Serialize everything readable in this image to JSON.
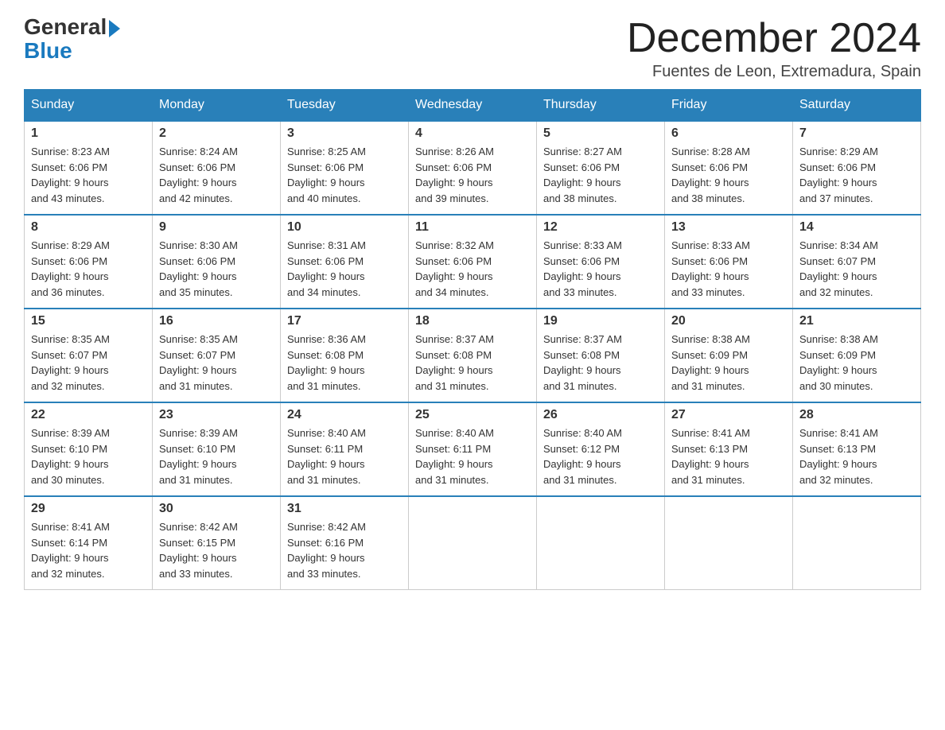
{
  "header": {
    "logo_line1": "General",
    "logo_line2": "Blue",
    "month_title": "December 2024",
    "location": "Fuentes de Leon, Extremadura, Spain"
  },
  "days_of_week": [
    "Sunday",
    "Monday",
    "Tuesday",
    "Wednesday",
    "Thursday",
    "Friday",
    "Saturday"
  ],
  "weeks": [
    [
      {
        "day": "1",
        "sunrise": "8:23 AM",
        "sunset": "6:06 PM",
        "daylight": "9 hours and 43 minutes."
      },
      {
        "day": "2",
        "sunrise": "8:24 AM",
        "sunset": "6:06 PM",
        "daylight": "9 hours and 42 minutes."
      },
      {
        "day": "3",
        "sunrise": "8:25 AM",
        "sunset": "6:06 PM",
        "daylight": "9 hours and 40 minutes."
      },
      {
        "day": "4",
        "sunrise": "8:26 AM",
        "sunset": "6:06 PM",
        "daylight": "9 hours and 39 minutes."
      },
      {
        "day": "5",
        "sunrise": "8:27 AM",
        "sunset": "6:06 PM",
        "daylight": "9 hours and 38 minutes."
      },
      {
        "day": "6",
        "sunrise": "8:28 AM",
        "sunset": "6:06 PM",
        "daylight": "9 hours and 38 minutes."
      },
      {
        "day": "7",
        "sunrise": "8:29 AM",
        "sunset": "6:06 PM",
        "daylight": "9 hours and 37 minutes."
      }
    ],
    [
      {
        "day": "8",
        "sunrise": "8:29 AM",
        "sunset": "6:06 PM",
        "daylight": "9 hours and 36 minutes."
      },
      {
        "day": "9",
        "sunrise": "8:30 AM",
        "sunset": "6:06 PM",
        "daylight": "9 hours and 35 minutes."
      },
      {
        "day": "10",
        "sunrise": "8:31 AM",
        "sunset": "6:06 PM",
        "daylight": "9 hours and 34 minutes."
      },
      {
        "day": "11",
        "sunrise": "8:32 AM",
        "sunset": "6:06 PM",
        "daylight": "9 hours and 34 minutes."
      },
      {
        "day": "12",
        "sunrise": "8:33 AM",
        "sunset": "6:06 PM",
        "daylight": "9 hours and 33 minutes."
      },
      {
        "day": "13",
        "sunrise": "8:33 AM",
        "sunset": "6:06 PM",
        "daylight": "9 hours and 33 minutes."
      },
      {
        "day": "14",
        "sunrise": "8:34 AM",
        "sunset": "6:07 PM",
        "daylight": "9 hours and 32 minutes."
      }
    ],
    [
      {
        "day": "15",
        "sunrise": "8:35 AM",
        "sunset": "6:07 PM",
        "daylight": "9 hours and 32 minutes."
      },
      {
        "day": "16",
        "sunrise": "8:35 AM",
        "sunset": "6:07 PM",
        "daylight": "9 hours and 31 minutes."
      },
      {
        "day": "17",
        "sunrise": "8:36 AM",
        "sunset": "6:08 PM",
        "daylight": "9 hours and 31 minutes."
      },
      {
        "day": "18",
        "sunrise": "8:37 AM",
        "sunset": "6:08 PM",
        "daylight": "9 hours and 31 minutes."
      },
      {
        "day": "19",
        "sunrise": "8:37 AM",
        "sunset": "6:08 PM",
        "daylight": "9 hours and 31 minutes."
      },
      {
        "day": "20",
        "sunrise": "8:38 AM",
        "sunset": "6:09 PM",
        "daylight": "9 hours and 31 minutes."
      },
      {
        "day": "21",
        "sunrise": "8:38 AM",
        "sunset": "6:09 PM",
        "daylight": "9 hours and 30 minutes."
      }
    ],
    [
      {
        "day": "22",
        "sunrise": "8:39 AM",
        "sunset": "6:10 PM",
        "daylight": "9 hours and 30 minutes."
      },
      {
        "day": "23",
        "sunrise": "8:39 AM",
        "sunset": "6:10 PM",
        "daylight": "9 hours and 31 minutes."
      },
      {
        "day": "24",
        "sunrise": "8:40 AM",
        "sunset": "6:11 PM",
        "daylight": "9 hours and 31 minutes."
      },
      {
        "day": "25",
        "sunrise": "8:40 AM",
        "sunset": "6:11 PM",
        "daylight": "9 hours and 31 minutes."
      },
      {
        "day": "26",
        "sunrise": "8:40 AM",
        "sunset": "6:12 PM",
        "daylight": "9 hours and 31 minutes."
      },
      {
        "day": "27",
        "sunrise": "8:41 AM",
        "sunset": "6:13 PM",
        "daylight": "9 hours and 31 minutes."
      },
      {
        "day": "28",
        "sunrise": "8:41 AM",
        "sunset": "6:13 PM",
        "daylight": "9 hours and 32 minutes."
      }
    ],
    [
      {
        "day": "29",
        "sunrise": "8:41 AM",
        "sunset": "6:14 PM",
        "daylight": "9 hours and 32 minutes."
      },
      {
        "day": "30",
        "sunrise": "8:42 AM",
        "sunset": "6:15 PM",
        "daylight": "9 hours and 33 minutes."
      },
      {
        "day": "31",
        "sunrise": "8:42 AM",
        "sunset": "6:16 PM",
        "daylight": "9 hours and 33 minutes."
      },
      null,
      null,
      null,
      null
    ]
  ],
  "labels": {
    "sunrise": "Sunrise:",
    "sunset": "Sunset:",
    "daylight": "Daylight:"
  }
}
